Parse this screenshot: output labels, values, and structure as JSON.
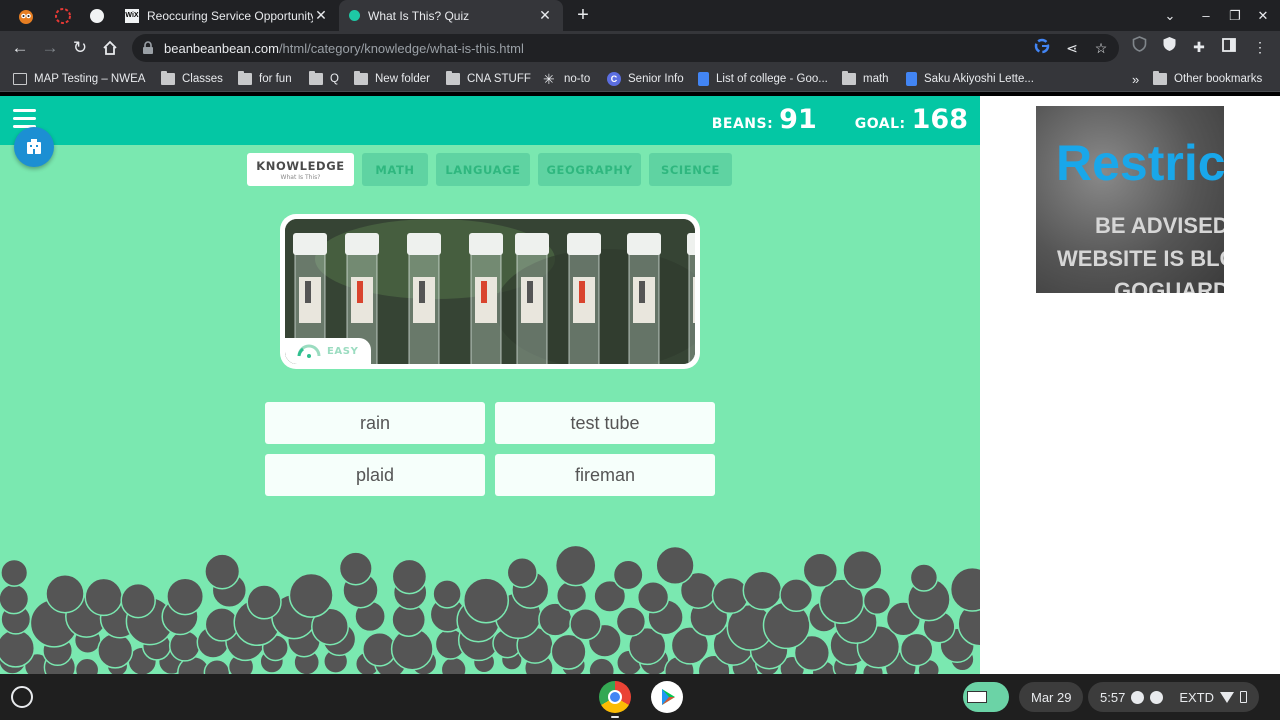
{
  "browser": {
    "tabs": [
      {
        "title": "Reoccuring Service Opportunity",
        "favicon": "wix-icon",
        "active": false
      },
      {
        "title": "What Is This? Quiz",
        "favicon": "teal-dot-icon",
        "active": true
      }
    ],
    "url_host": "beanbeanbean.com",
    "url_path": "/html/category/knowledge/what-is-this.html",
    "bookmarks": [
      {
        "label": "MAP Testing – NWEA",
        "icon": "page-icon"
      },
      {
        "label": "Classes",
        "icon": "folder-icon"
      },
      {
        "label": "for fun",
        "icon": "folder-icon"
      },
      {
        "label": "Q",
        "icon": "folder-icon"
      },
      {
        "label": "New folder",
        "icon": "folder-icon"
      },
      {
        "label": "CNA STUFF",
        "icon": "folder-icon"
      },
      {
        "label": "no-to",
        "icon": "asterisk-icon"
      },
      {
        "label": "Senior Info",
        "icon": "c-logo-icon"
      },
      {
        "label": "List of college - Goo...",
        "icon": "doc-icon"
      },
      {
        "label": "math",
        "icon": "folder-icon"
      },
      {
        "label": "Saku Akiyoshi Lette...",
        "icon": "doc-icon"
      }
    ],
    "more_bookmarks": "»",
    "other_bookmarks": "Other bookmarks"
  },
  "game": {
    "beans_label": "BEANS:",
    "beans_value": "91",
    "goal_label": "GOAL:",
    "goal_value": "168",
    "categories": [
      {
        "label": "KNOWLEDGE",
        "sub": "What Is This?",
        "active": true
      },
      {
        "label": "MATH",
        "active": false
      },
      {
        "label": "LANGUAGE",
        "active": false
      },
      {
        "label": "GEOGRAPHY",
        "active": false
      },
      {
        "label": "SCIENCE",
        "active": false
      }
    ],
    "difficulty": "EASY",
    "answers": [
      "rain",
      "test tube",
      "plaid",
      "fireman"
    ],
    "accent_color": "#04c7a4",
    "background_color": "#7ae8b0",
    "bean_color": "#555555"
  },
  "ad": {
    "headline": "Restric",
    "line1": "BE ADVISED",
    "line2": "WEBSITE IS BLO",
    "line3": "GOGUARDI"
  },
  "shelf": {
    "date": "Mar 29",
    "time": "5:57",
    "status": "EXTD"
  }
}
